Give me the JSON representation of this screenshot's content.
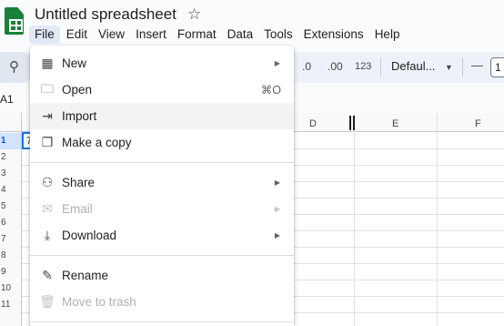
{
  "app": {
    "doc_title": "Untitled spreadsheet",
    "icons": {
      "logo": "sheets-logo-icon",
      "star": "star-icon"
    }
  },
  "menubar": [
    "File",
    "Edit",
    "View",
    "Insert",
    "Format",
    "Data",
    "Tools",
    "Extensions",
    "Help"
  ],
  "toolbar": {
    "decrease_decimal": ".0",
    "increase_decimal": ".00",
    "number_format": "123",
    "font_family": "Defaul...",
    "font_size_minus": "—",
    "font_size": "1"
  },
  "formula_bar": {
    "cell_ref": "A1"
  },
  "grid": {
    "columns": [
      "D",
      "E",
      "F"
    ],
    "rows": [
      "1",
      "2",
      "3",
      "4",
      "5",
      "6",
      "7",
      "8",
      "9",
      "10",
      "11"
    ],
    "active_cell_value": "7"
  },
  "file_menu": {
    "items": [
      {
        "label": "New",
        "icon": "new-sheet-icon",
        "submenu": true
      },
      {
        "label": "Open",
        "icon": "folder-icon",
        "shortcut": "⌘O"
      },
      {
        "label": "Import",
        "icon": "import-icon",
        "hover": true
      },
      {
        "label": "Make a copy",
        "icon": "copy-icon"
      },
      {
        "label": "Share",
        "icon": "person-add-icon",
        "submenu": true
      },
      {
        "label": "Email",
        "icon": "email-icon",
        "submenu": true,
        "disabled": true
      },
      {
        "label": "Download",
        "icon": "download-icon",
        "submenu": true
      },
      {
        "label": "Rename",
        "icon": "rename-icon"
      },
      {
        "label": "Move to trash",
        "icon": "trash-icon",
        "disabled": true
      }
    ]
  },
  "colors": {
    "accent": "#1a73e8",
    "brand_green": "#188038",
    "toolbar_bg": "#edf2fa"
  }
}
